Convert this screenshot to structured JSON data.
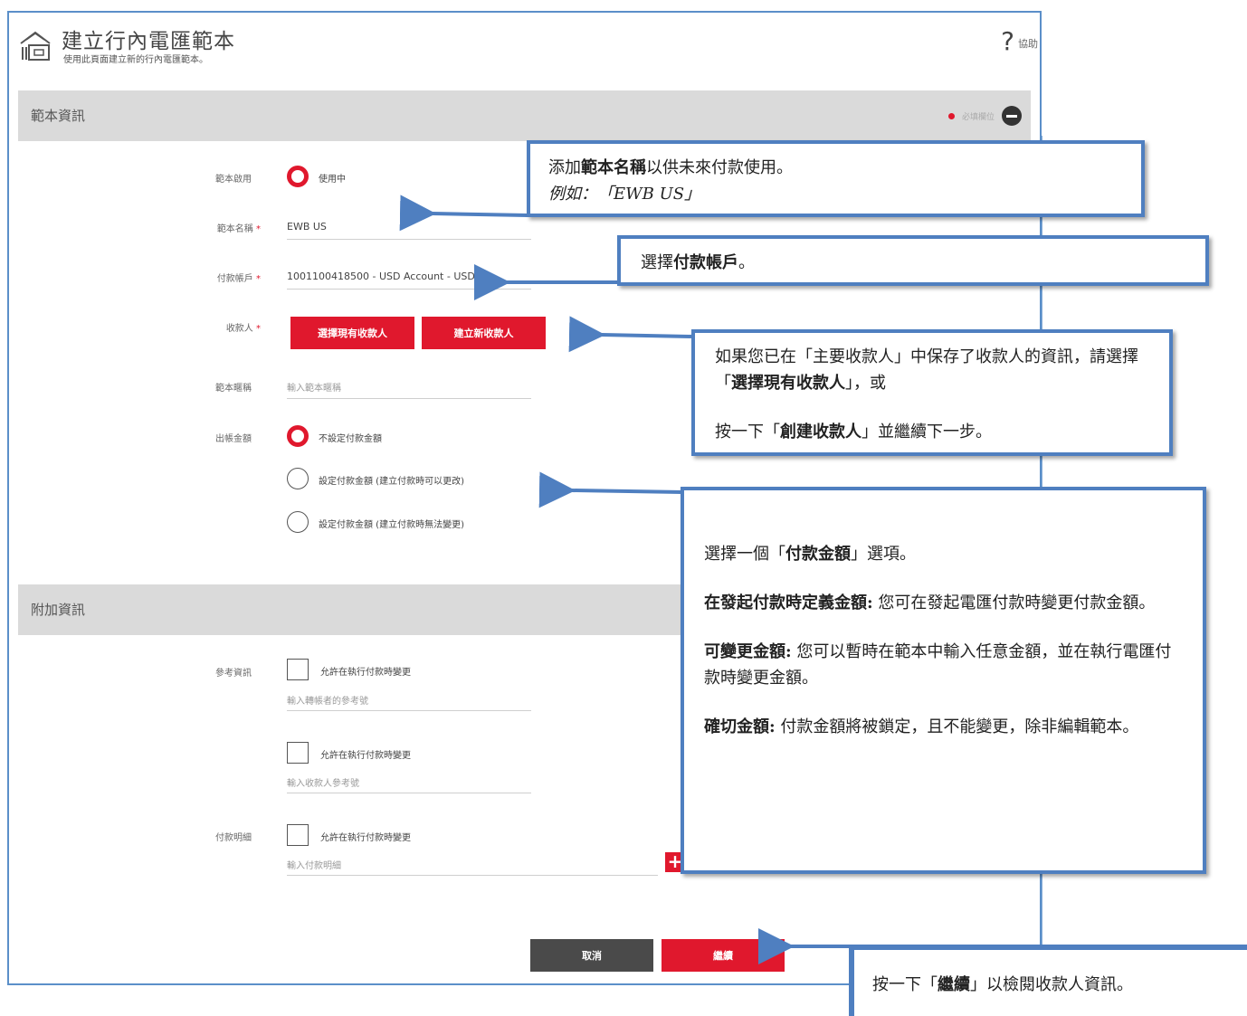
{
  "header": {
    "title": "建立行內電匯範本",
    "subtitle": "使用此頁面建立新的行內電匯範本。",
    "help_label": "協助"
  },
  "template_section": {
    "title": "範本資訊",
    "required_note": "必填欄位",
    "status": {
      "label": "範本啟用",
      "option": "使用中"
    },
    "name": {
      "label": "範本名稱",
      "value": "EWB US"
    },
    "account": {
      "label": "付款帳戶",
      "value": "1001100418500 - USD Account - USD"
    },
    "payee": {
      "label": "收款人",
      "select_existing": "選擇現有收款人",
      "create_new": "建立新收款人"
    },
    "nickname": {
      "label": "範本暱稱",
      "placeholder": "輸入範本暱稱"
    },
    "amount": {
      "label": "出帳金額",
      "options": [
        "不設定付款金額",
        "設定付款金額 (建立付款時可以更改)",
        "設定付款金額 (建立付款時無法變更)"
      ]
    }
  },
  "additional_section": {
    "title": "附加資訊",
    "reference": {
      "label": "參考資訊",
      "checkbox": "允許在執行付款時變更",
      "placeholder": "輸入轉帳者的參考號"
    },
    "payee_reference": {
      "checkbox": "允許在執行付款時變更",
      "placeholder": "輸入收款人參考號"
    },
    "payment_details": {
      "label": "付款明細",
      "checkbox": "允許在執行付款時變更",
      "placeholder": "輸入付款明細"
    }
  },
  "footer": {
    "cancel": "取消",
    "continue": "繼續"
  },
  "callouts": {
    "name": {
      "pre": "添加",
      "bold": "範本名稱",
      "post": "以供未來付款使用。",
      "example": "例如：「EWB US」"
    },
    "account": {
      "pre": "選擇",
      "bold": "付款帳戶",
      "post": "。"
    },
    "payee": {
      "l1_pre": "如果您已在「主要收款人」中保存了收款人的資訊，請選擇「",
      "l1_bold": "選擇現有收款人",
      "l1_post": "」，或",
      "l2_pre": "按一下「",
      "l2_bold": "創建收款人",
      "l2_post": "」並繼續下一步。"
    },
    "amount": {
      "intro_pre": "選擇一個「",
      "intro_bold": "付款金額",
      "intro_post": "」選項。",
      "p1_bold": "在發起付款時定義金額:",
      "p1_text": "  您可在發起電匯付款時變更付款金額。",
      "p2_bold": "可變更金額:",
      "p2_text": " 您可以暫時在範本中輸入任意金額，並在執行電匯付款時變更金額。",
      "p3_bold": "確切金額:",
      "p3_text": " 付款金額將被鎖定，且不能變更，除非編輯範本。"
    },
    "continue": {
      "pre": "按一下「",
      "bold": "繼續",
      "post": "」以檢閱收款人資訊。"
    }
  },
  "colors": {
    "accent": "#e0182d",
    "callout_border": "#4f7fc0",
    "window_border": "#5b8fc9"
  }
}
